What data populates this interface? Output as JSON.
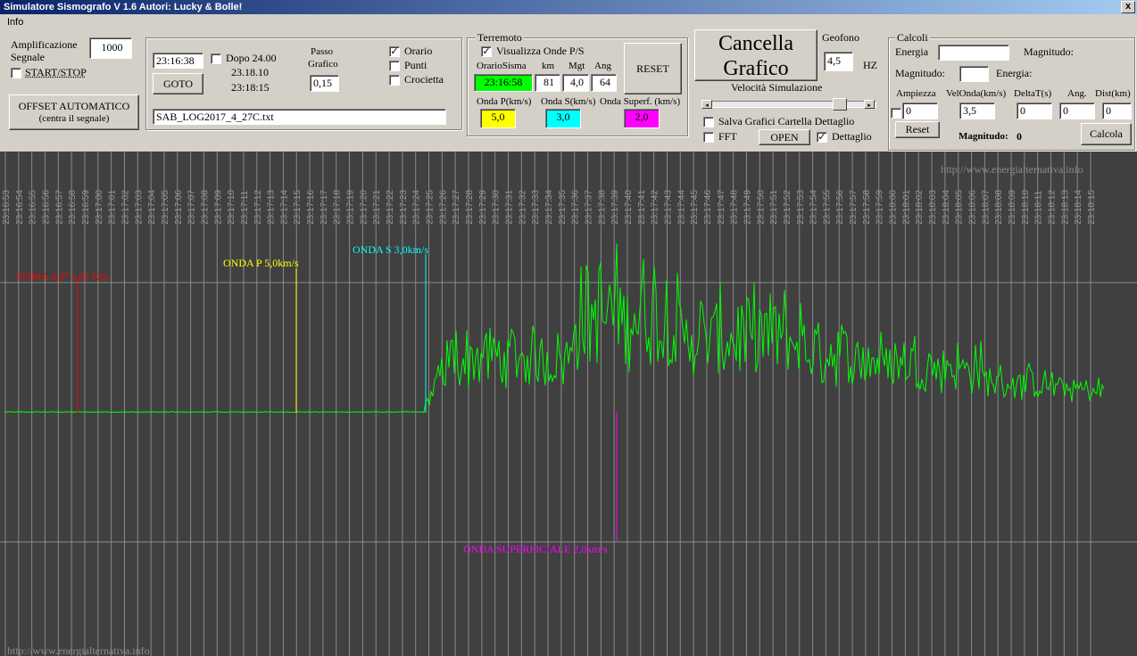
{
  "window": {
    "title": "Simulatore Sismografo V 1.6  Autori: Lucky & Bolle!",
    "close_label": "x"
  },
  "menu": {
    "info": "Info"
  },
  "amp": {
    "label1": "Amplificazione",
    "label2": "Segnale",
    "value": "1000",
    "start_stop": "START/STOP",
    "offset_line1": "OFFSET AUTOMATICO",
    "offset_line2": "(centra il segnale)"
  },
  "time": {
    "goto_time": "23:16:38",
    "goto_label": "GOTO",
    "dopo_label": "Dopo 24.00",
    "time1": "23.18.10",
    "time2": "23:18:15",
    "passo_label1": "Passo",
    "passo_label2": "Grafico",
    "passo_value": "0,15",
    "orario_label": "Orario",
    "orario_checked": "✓",
    "punti_label": "Punti",
    "crocietta_label": "Crocietta",
    "filename": "SAB_LOG2017_4_27C.txt"
  },
  "quake": {
    "title": "Terremoto",
    "visualizza_label": "Visualizza Onde P/S",
    "visualizza_checked": "✓",
    "hdr_orario": "OrarioSisma",
    "hdr_km": "km",
    "hdr_mgt": "Mgt",
    "hdr_ang": "Ang",
    "orario": "23:16:58",
    "km": "81",
    "mgt": "4,0",
    "ang": "64",
    "reset_label": "RESET",
    "p_label": "Onda P(km/s)",
    "s_label": "Onda S(km/s)",
    "sup_label": "Onda Superf. (km/s)",
    "p_value": "5,0",
    "s_value": "3,0",
    "sup_value": "2,0",
    "p_color": "#ffff00",
    "s_color": "#00ffff",
    "sup_color": "#ff00ff",
    "orario_color": "#00ff00"
  },
  "graph_ctrl": {
    "cancella_line1": "Cancella",
    "cancella_line2": "Grafico",
    "geofono_label": "Geofono",
    "geofono_value": "4,5",
    "hz_label": "HZ",
    "velocita_label": "Velocità Simulazione",
    "salva_label": "Salva Grafici Cartella Dettaglio",
    "fft_label": "FFT",
    "open_label": "OPEN",
    "dettaglio_label": "Dettaglio",
    "dettaglio_checked": "✓",
    "slider_position": 0.93
  },
  "calc": {
    "title": "Calcoli",
    "energia_label": "Energia",
    "energia_value": "",
    "magnitudo_label": "Magnitudo:",
    "magnitudo2_label": "Magnitudo:",
    "magnitudo2_value": "",
    "energia2_label": "Energia:",
    "ampiezza_label": "Ampiezza",
    "velonda_label": "VelOnda(km/s)",
    "deltat_label": "DeltaT(s)",
    "ang_label": "Ang.",
    "dist_label": "Dist(km)",
    "ampiezza_value": "0",
    "velonda_value": "3,5",
    "deltat_value": "0",
    "ang_value": "0",
    "dist_value": "0",
    "reset_label": "Reset",
    "magnitudo_result_label": "Magnitudo:",
    "magnitudo_result": "0",
    "calcola_label": "Calcola"
  },
  "plot": {
    "watermark_top": "http://www.energialternativa.info",
    "watermark_bottom": "http://www.energialternativa.info",
    "sisma_label": "SISMA 4,0° a 81 Km",
    "p_label": "ONDA P 5,0km/s",
    "s_label": "ONDA S 3,0km/s",
    "sup_label": "ONDA SUPERFICIALE 2,0km/s",
    "sisma_color": "#ff0000",
    "signal_color": "#00ff00",
    "time_ticks": [
      "23:16:53",
      "23:16:54",
      "23:16:55",
      "23:16:56",
      "23:16:57",
      "23:16:58",
      "23:16:59",
      "23:17:00",
      "23:17:01",
      "23:17:02",
      "23:17:03",
      "23:17:04",
      "23:17:05",
      "23:17:06",
      "23:17:07",
      "23:17:08",
      "23:17:09",
      "23:17:10",
      "23:17:11",
      "23:17:12",
      "23:17:13",
      "23:17:14",
      "23:17:15",
      "23:17:16",
      "23:17:17",
      "23:17:18",
      "23:17:19",
      "23:17:20",
      "23:17:21",
      "23:17:22",
      "23:17:23",
      "23:17:24",
      "23:17:25",
      "23:17:26",
      "23:17:27",
      "23:17:28",
      "23:17:29",
      "23:17:30",
      "23:17:31",
      "23:17:32",
      "23:17:33",
      "23:17:34",
      "23:17:35",
      "23:17:36",
      "23:17:37",
      "23:17:38",
      "23:17:39",
      "23:17:40",
      "23:17:41",
      "23:17:42",
      "23:17:43",
      "23:17:44",
      "23:17:45",
      "23:17:46",
      "23:17:47",
      "23:17:48",
      "23:17:49",
      "23:17:50",
      "23:17:51",
      "23:17:52",
      "23:17:53",
      "23:17:54",
      "23:17:55",
      "23:17:56",
      "23:17:57",
      "23:17:58",
      "23:17:59",
      "23:18:00",
      "23:18:01",
      "23:18:02",
      "23:18:03",
      "23:18:04",
      "23:18:05",
      "23:18:06",
      "23:18:07",
      "23:18:08",
      "23:18:09",
      "23:18:10",
      "23:18:11",
      "23:18:12",
      "23:18:13",
      "23:18:14",
      "23:18:15"
    ]
  }
}
